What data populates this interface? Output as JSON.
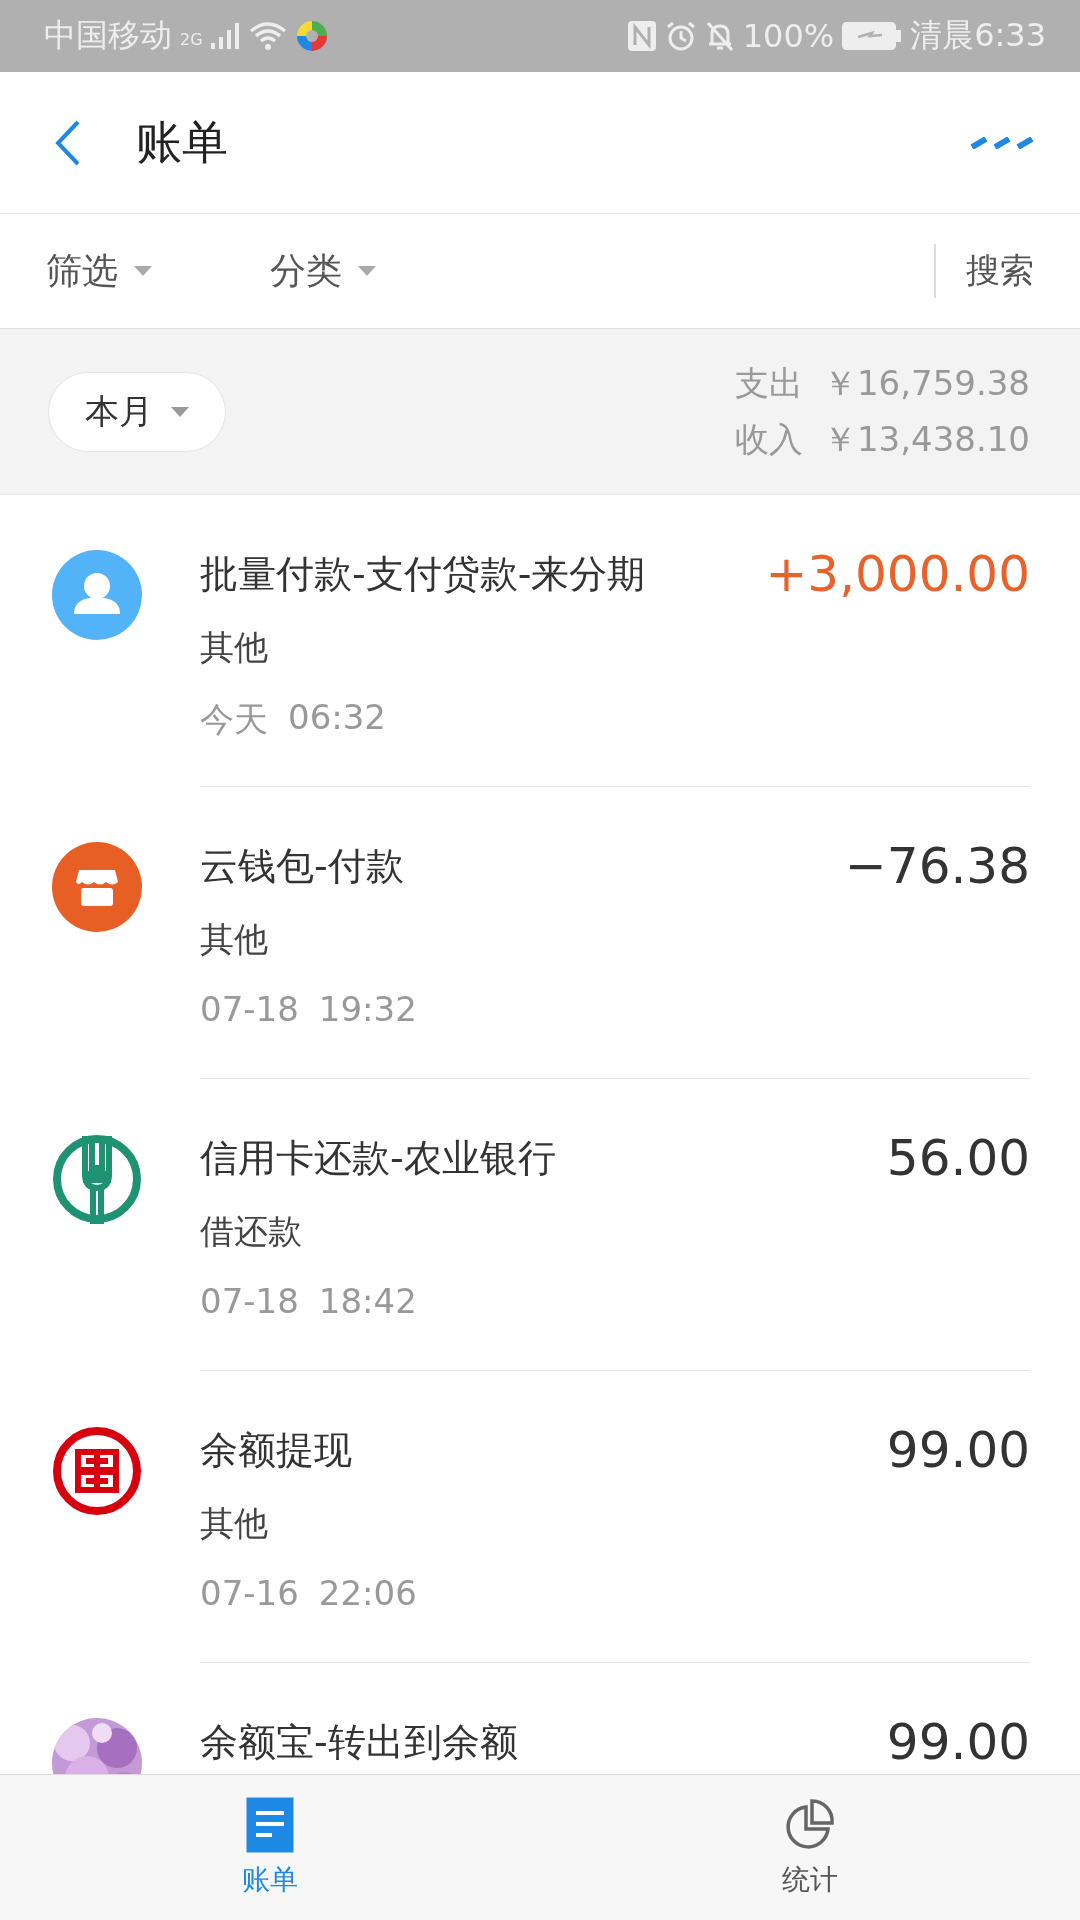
{
  "status_bar": {
    "carrier": "中国移动",
    "network": "2G",
    "battery": "100%",
    "time": "清晨6:33"
  },
  "header": {
    "title": "账单"
  },
  "filters": [
    {
      "label": "筛选"
    },
    {
      "label": "分类"
    }
  ],
  "search": {
    "label": "搜索"
  },
  "summary": {
    "period": "本月",
    "expense_label": "支出",
    "expense": "￥16,759.38",
    "income_label": "收入",
    "income": "￥13,438.10"
  },
  "transactions": [
    {
      "kind": "person",
      "title": "批量付款-支付贷款-来分期",
      "amount": "+3,000.00",
      "income": true,
      "category": "其他",
      "date": "今天",
      "time": "06:32"
    },
    {
      "kind": "shop",
      "title": "云钱包-付款",
      "amount": "−76.38",
      "income": false,
      "category": "其他",
      "date": "07-18",
      "time": "19:32"
    },
    {
      "kind": "abc",
      "title": "信用卡还款-农业银行",
      "amount": "56.00",
      "income": false,
      "category": "借还款",
      "date": "07-18",
      "time": "18:42"
    },
    {
      "kind": "icbc",
      "title": "余额提现",
      "amount": "99.00",
      "income": false,
      "category": "其他",
      "date": "07-16",
      "time": "22:06"
    },
    {
      "kind": "picture",
      "title": "余额宝-转出到余额",
      "amount": "99.00",
      "income": false
    }
  ],
  "tabs": [
    {
      "label": "账单",
      "kind": "bill",
      "selected": true
    },
    {
      "label": "统计",
      "kind": "chart",
      "selected": false
    }
  ]
}
